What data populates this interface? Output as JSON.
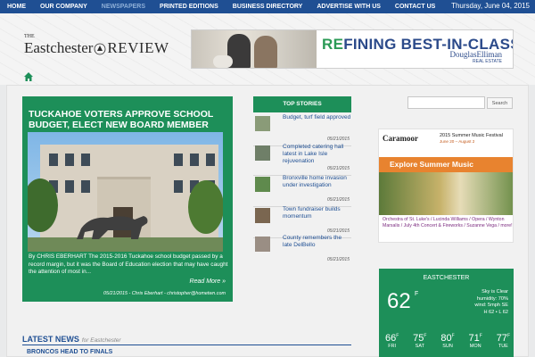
{
  "nav": {
    "items": [
      {
        "label": "HOME",
        "active": false
      },
      {
        "label": "OUR COMPANY",
        "active": false
      },
      {
        "label": "NEWSPAPERS",
        "active": true
      },
      {
        "label": "PRINTED EDITIONS",
        "active": false
      },
      {
        "label": "BUSINESS DIRECTORY",
        "active": false
      },
      {
        "label": "ADVERTISE WITH US",
        "active": false
      },
      {
        "label": "CONTACT US",
        "active": false
      }
    ],
    "date": "Thursday, June 04, 2015"
  },
  "logo": {
    "the": "THE",
    "part1": "Eastchester",
    "part2": "REVIEW"
  },
  "ad_banner": {
    "headline_green": "RE",
    "headline_mid": "FINING BEST-IN-CLASS.",
    "brand": "DouglasElliman",
    "brand_sub": "REAL ESTATE"
  },
  "featured": {
    "title": "TUCKAHOE VOTERS APPROVE SCHOOL BUDGET, ELECT NEW BOARD MEMBER",
    "excerpt": "By CHRIS EBERHART The 2015-2016 Tuckahoe school budget passed by a record margin, but it was the Board of Education election that may have caught the attention of most in...",
    "read_more": "Read More »",
    "byline": "05/21/2015 - Chris Eberhart - christopher@hometwn.com"
  },
  "top_stories": {
    "header": "TOP STORIES",
    "items": [
      {
        "title": "Budget, turf field approved",
        "date": "05/21/2015"
      },
      {
        "title": "Completed catering hall latest in Lake Isle rejuvenation",
        "date": "05/21/2015"
      },
      {
        "title": "Bronxville home invasion under investigation",
        "date": "05/21/2015"
      },
      {
        "title": "Town fundraiser builds momentum",
        "date": "05/21/2015"
      },
      {
        "title": "County remembers the late DelBello",
        "date": "05/21/2015"
      }
    ]
  },
  "latest_news": {
    "label": "LATEST NEWS",
    "sub": "for Eastchester",
    "first_item": "BRONCOS HEAD TO FINALS"
  },
  "search": {
    "placeholder": "",
    "button": "Search"
  },
  "side_ad": {
    "brand": "Caramoor",
    "season": "2015 Summer Music Festival",
    "dates": "June 20 – August 2",
    "explore": "Explore Summer Music",
    "performers": "Orchestra of St. Luke's / Lucinda Williams / Opera / Wynton Marsalis / July 4th Concert & Fireworks / Suzanne Vega / more!"
  },
  "weather": {
    "city": "EASTCHESTER",
    "temp": "62",
    "unit": "F",
    "condition": "Sky is Clear",
    "humidity": "humidity: 70%",
    "wind": "wind: 5mph SE",
    "hilo": "H 62 • L 62",
    "forecast": [
      {
        "temp": "66",
        "day": "FRI"
      },
      {
        "temp": "75",
        "day": "SAT"
      },
      {
        "temp": "80",
        "day": "SUN"
      },
      {
        "temp": "71",
        "day": "MON"
      },
      {
        "temp": "77",
        "day": "TUE"
      }
    ]
  },
  "colors": {
    "nav_blue": "#1f4f93",
    "brand_green": "#1d8f59",
    "orange": "#e8832f"
  }
}
